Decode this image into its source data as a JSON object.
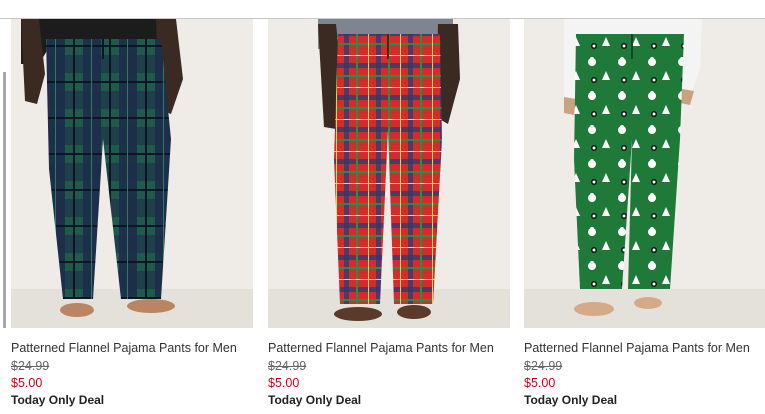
{
  "colors": {
    "sale_price": "#d0021b",
    "background": "#ffffff",
    "image_bg": "#efece8"
  },
  "products": [
    {
      "name": "Patterned Flannel Pajama Pants for Men",
      "old_price": "$24.99",
      "sale_price": "$5.00",
      "deal_label": "Today Only Deal",
      "pattern": "green-navy-plaid"
    },
    {
      "name": "Patterned Flannel Pajama Pants for Men",
      "old_price": "$24.99",
      "sale_price": "$5.00",
      "deal_label": "Today Only Deal",
      "pattern": "red-tartan"
    },
    {
      "name": "Patterned Flannel Pajama Pants for Men",
      "old_price": "$24.99",
      "sale_price": "$5.00",
      "deal_label": "Today Only Deal",
      "pattern": "green-holiday-print"
    }
  ]
}
